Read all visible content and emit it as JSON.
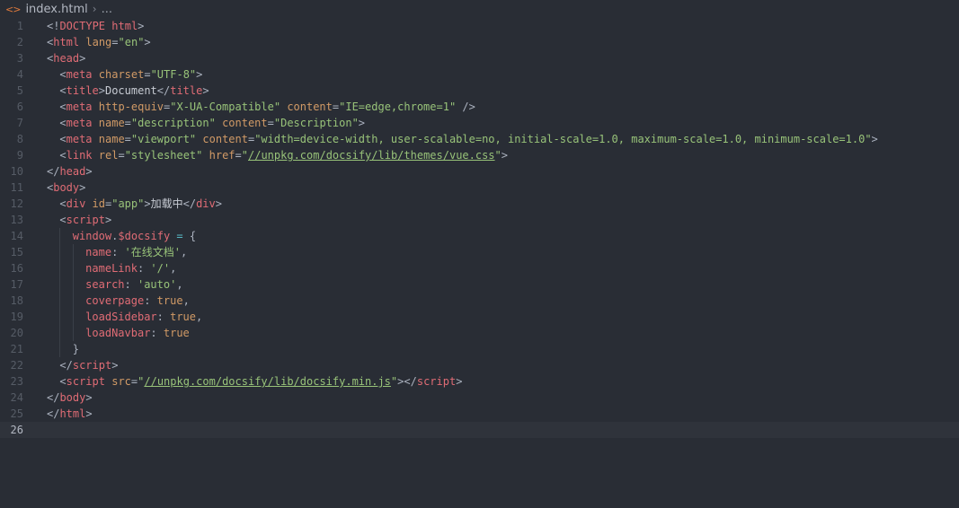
{
  "breadcrumb": {
    "file_name": "index.html",
    "ellipsis": "..."
  },
  "editor": {
    "current_line": 26,
    "lines": [
      {
        "n": "1",
        "indent": 0,
        "tokens": [
          [
            "p",
            "<!"
          ],
          [
            "tag",
            "DOCTYPE"
          ],
          [
            "p",
            " "
          ],
          [
            "tag",
            "html"
          ],
          [
            "p",
            ">"
          ]
        ]
      },
      {
        "n": "2",
        "indent": 0,
        "tokens": [
          [
            "p",
            "<"
          ],
          [
            "tag",
            "html"
          ],
          [
            "p",
            " "
          ],
          [
            "attr",
            "lang"
          ],
          [
            "p",
            "="
          ],
          [
            "str",
            "\"en\""
          ],
          [
            "p",
            ">"
          ]
        ]
      },
      {
        "n": "3",
        "indent": 0,
        "tokens": [
          [
            "p",
            "<"
          ],
          [
            "tag",
            "head"
          ],
          [
            "p",
            ">"
          ]
        ]
      },
      {
        "n": "4",
        "indent": 1,
        "tokens": [
          [
            "p",
            "<"
          ],
          [
            "tag",
            "meta"
          ],
          [
            "p",
            " "
          ],
          [
            "attr",
            "charset"
          ],
          [
            "p",
            "="
          ],
          [
            "str",
            "\"UTF-8\""
          ],
          [
            "p",
            ">"
          ]
        ]
      },
      {
        "n": "5",
        "indent": 1,
        "tokens": [
          [
            "p",
            "<"
          ],
          [
            "tag",
            "title"
          ],
          [
            "p",
            ">"
          ],
          [
            "txt",
            "Document"
          ],
          [
            "p",
            "</"
          ],
          [
            "tag",
            "title"
          ],
          [
            "p",
            ">"
          ]
        ]
      },
      {
        "n": "6",
        "indent": 1,
        "tokens": [
          [
            "p",
            "<"
          ],
          [
            "tag",
            "meta"
          ],
          [
            "p",
            " "
          ],
          [
            "attr",
            "http-equiv"
          ],
          [
            "p",
            "="
          ],
          [
            "str",
            "\"X-UA-Compatible\""
          ],
          [
            "p",
            " "
          ],
          [
            "attr",
            "content"
          ],
          [
            "p",
            "="
          ],
          [
            "str",
            "\"IE=edge,chrome=1\""
          ],
          [
            "p",
            " />"
          ]
        ]
      },
      {
        "n": "7",
        "indent": 1,
        "tokens": [
          [
            "p",
            "<"
          ],
          [
            "tag",
            "meta"
          ],
          [
            "p",
            " "
          ],
          [
            "attr",
            "name"
          ],
          [
            "p",
            "="
          ],
          [
            "str",
            "\"description\""
          ],
          [
            "p",
            " "
          ],
          [
            "attr",
            "content"
          ],
          [
            "p",
            "="
          ],
          [
            "str",
            "\"Description\""
          ],
          [
            "p",
            ">"
          ]
        ]
      },
      {
        "n": "8",
        "indent": 1,
        "tokens": [
          [
            "p",
            "<"
          ],
          [
            "tag",
            "meta"
          ],
          [
            "p",
            " "
          ],
          [
            "attr",
            "name"
          ],
          [
            "p",
            "="
          ],
          [
            "str",
            "\"viewport\""
          ],
          [
            "p",
            " "
          ],
          [
            "attr",
            "content"
          ],
          [
            "p",
            "="
          ],
          [
            "str",
            "\"width=device-width, user-scalable=no, initial-scale=1.0, maximum-scale=1.0, minimum-scale=1.0\""
          ],
          [
            "p",
            ">"
          ]
        ]
      },
      {
        "n": "9",
        "indent": 1,
        "tokens": [
          [
            "p",
            "<"
          ],
          [
            "tag",
            "link"
          ],
          [
            "p",
            " "
          ],
          [
            "attr",
            "rel"
          ],
          [
            "p",
            "="
          ],
          [
            "str",
            "\"stylesheet\""
          ],
          [
            "p",
            " "
          ],
          [
            "attr",
            "href"
          ],
          [
            "p",
            "="
          ],
          [
            "str",
            "\""
          ],
          [
            "str url",
            "//unpkg.com/docsify/lib/themes/vue.css"
          ],
          [
            "str",
            "\""
          ],
          [
            "p",
            ">"
          ]
        ]
      },
      {
        "n": "10",
        "indent": 0,
        "tokens": [
          [
            "p",
            "</"
          ],
          [
            "tag",
            "head"
          ],
          [
            "p",
            ">"
          ]
        ]
      },
      {
        "n": "11",
        "indent": 0,
        "tokens": [
          [
            "p",
            "<"
          ],
          [
            "tag",
            "body"
          ],
          [
            "p",
            ">"
          ]
        ]
      },
      {
        "n": "12",
        "indent": 1,
        "tokens": [
          [
            "p",
            "<"
          ],
          [
            "tag",
            "div"
          ],
          [
            "p",
            " "
          ],
          [
            "attr",
            "id"
          ],
          [
            "p",
            "="
          ],
          [
            "str",
            "\"app\""
          ],
          [
            "p",
            ">"
          ],
          [
            "txt",
            "加载中"
          ],
          [
            "p",
            "</"
          ],
          [
            "tag",
            "div"
          ],
          [
            "p",
            ">"
          ]
        ]
      },
      {
        "n": "13",
        "indent": 1,
        "tokens": [
          [
            "p",
            "<"
          ],
          [
            "tag",
            "script"
          ],
          [
            "p",
            ">"
          ]
        ]
      },
      {
        "n": "14",
        "indent": 2,
        "tokens": [
          [
            "key",
            "window"
          ],
          [
            "p",
            "."
          ],
          [
            "key",
            "$docsify"
          ],
          [
            "p",
            " "
          ],
          [
            "op",
            "="
          ],
          [
            "p",
            " {"
          ]
        ]
      },
      {
        "n": "15",
        "indent": 3,
        "tokens": [
          [
            "key",
            "name"
          ],
          [
            "p",
            ": "
          ],
          [
            "str",
            "'在线文档'"
          ],
          [
            "p",
            ","
          ]
        ]
      },
      {
        "n": "16",
        "indent": 3,
        "tokens": [
          [
            "key",
            "nameLink"
          ],
          [
            "p",
            ": "
          ],
          [
            "str",
            "'/'"
          ],
          [
            "p",
            ","
          ]
        ]
      },
      {
        "n": "17",
        "indent": 3,
        "tokens": [
          [
            "key",
            "search"
          ],
          [
            "p",
            ": "
          ],
          [
            "str",
            "'auto'"
          ],
          [
            "p",
            ","
          ]
        ]
      },
      {
        "n": "18",
        "indent": 3,
        "tokens": [
          [
            "key",
            "coverpage"
          ],
          [
            "p",
            ": "
          ],
          [
            "kw",
            "true"
          ],
          [
            "p",
            ","
          ]
        ]
      },
      {
        "n": "19",
        "indent": 3,
        "tokens": [
          [
            "key",
            "loadSidebar"
          ],
          [
            "p",
            ": "
          ],
          [
            "kw",
            "true"
          ],
          [
            "p",
            ","
          ]
        ]
      },
      {
        "n": "20",
        "indent": 3,
        "tokens": [
          [
            "key",
            "loadNavbar"
          ],
          [
            "p",
            ": "
          ],
          [
            "kw",
            "true"
          ]
        ]
      },
      {
        "n": "21",
        "indent": 2,
        "tokens": [
          [
            "p",
            "}"
          ]
        ]
      },
      {
        "n": "22",
        "indent": 1,
        "tokens": [
          [
            "p",
            "</"
          ],
          [
            "tag",
            "script"
          ],
          [
            "p",
            ">"
          ]
        ]
      },
      {
        "n": "23",
        "indent": 1,
        "tokens": [
          [
            "p",
            "<"
          ],
          [
            "tag",
            "script"
          ],
          [
            "p",
            " "
          ],
          [
            "attr",
            "src"
          ],
          [
            "p",
            "="
          ],
          [
            "str",
            "\""
          ],
          [
            "str url",
            "//unpkg.com/docsify/lib/docsify.min.js"
          ],
          [
            "str",
            "\""
          ],
          [
            "p",
            "></"
          ],
          [
            "tag",
            "script"
          ],
          [
            "p",
            ">"
          ]
        ]
      },
      {
        "n": "24",
        "indent": 0,
        "tokens": [
          [
            "p",
            "</"
          ],
          [
            "tag",
            "body"
          ],
          [
            "p",
            ">"
          ]
        ]
      },
      {
        "n": "25",
        "indent": 0,
        "tokens": [
          [
            "p",
            "</"
          ],
          [
            "tag",
            "html"
          ],
          [
            "p",
            ">"
          ]
        ]
      },
      {
        "n": "26",
        "indent": 0,
        "tokens": []
      }
    ]
  },
  "colors": {
    "background": "#292d35",
    "current_line": "#2f333b",
    "tag": "#e06c75",
    "attribute": "#d19a66",
    "string": "#98c379",
    "file_icon": "#e07a3c"
  },
  "icons": {
    "file": "html-file-icon",
    "separator": "chevron-right-icon"
  }
}
